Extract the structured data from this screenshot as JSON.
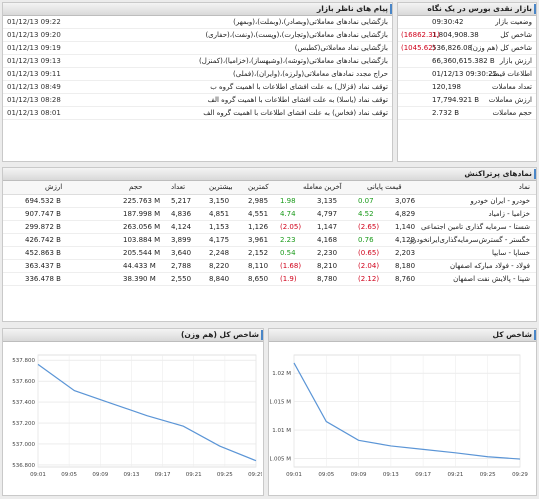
{
  "messages": {
    "title": "پیام های ناظر بازار",
    "items": [
      {
        "time": "01/12/13 09:22",
        "text": "بازگشایی نمادهای معاملاتی(وبصادر)،(وبملت)،(وبمهر)"
      },
      {
        "time": "01/12/13 09:20",
        "text": "بازگشایی نمادهای معاملاتی(وتجارت)،(وپست)،(ونفت)،(حفاری)"
      },
      {
        "time": "01/12/13 09:19",
        "text": "بازگشایی نماد معاملاتی(کطبس)"
      },
      {
        "time": "01/12/13 09:13",
        "text": "بازگشایی نمادهای معاملاتی(وتوشه)،(وشبهساز)،(خزامیا)،(کمنزل)"
      },
      {
        "time": "01/12/13 09:11",
        "text": "حراج مجدد نمادهای معاملاتی(ولرزه)،(وایران)،(فملی)"
      },
      {
        "time": "01/12/13 08:49",
        "text": "توقف نماد (قزلال) به علت افشای اطلاعات با اهمیت گروه ب"
      },
      {
        "time": "01/12/13 08:28",
        "text": "توقف نماد (یاسلا) به علت افشای اطلاعات با اهمیت گروه الف"
      },
      {
        "time": "01/12/13 08:01",
        "text": "توقف نماد (فخاس) به علت افشای اطلاعات با اهمیت گروه الف"
      }
    ]
  },
  "market": {
    "title": "بازار نقدی بورس در یک نگاه",
    "rows": [
      {
        "label": "وضعیت بازار",
        "value": "09:30:42",
        "change": ""
      },
      {
        "label": "شاخص کل",
        "value": "1,804,908.38",
        "change": "(16862.31)"
      },
      {
        "label": "شاخص کل (هم وزن)",
        "value": "536,826.08",
        "change": "(1045.62)"
      },
      {
        "label": "ارزش بازار",
        "value": "66,360,615.382 B",
        "change": ""
      },
      {
        "label": "اطلاعات قیمت",
        "value": "01/12/13 09:30:25",
        "change": ""
      },
      {
        "label": "تعداد معاملات",
        "value": "120,198",
        "change": ""
      },
      {
        "label": "ارزش معاملات",
        "value": "17,794.921 B",
        "change": ""
      },
      {
        "label": "حجم معاملات",
        "value": "2.732 B",
        "change": ""
      }
    ]
  },
  "influential": {
    "title": "نمادهای پرتراکنش",
    "headers": {
      "symbol": "نماد",
      "close": "قیمت پایانی",
      "last": "آخرین معامله",
      "min": "کمترین",
      "max": "بیشترین",
      "count": "تعداد",
      "volume": "حجم",
      "value": "ارزش"
    },
    "rows": [
      {
        "symbol": "خودرو - ایران خودرو",
        "close": "3,076",
        "close_chg": "0.07",
        "last": "3,135",
        "last_chg": "1.98",
        "min": "2,985",
        "max": "3,150",
        "count": "5,217",
        "volume": "225.763 M",
        "value": "694.532 B",
        "close_dir": "pos",
        "last_dir": "pos"
      },
      {
        "symbol": "خزامیا - زامیاد",
        "close": "4,829",
        "close_chg": "4.52",
        "last": "4,797",
        "last_chg": "4.74",
        "min": "4,551",
        "max": "4,851",
        "count": "4,836",
        "volume": "187.998 M",
        "value": "907.747 B",
        "close_dir": "pos",
        "last_dir": "pos"
      },
      {
        "symbol": "شستا - سرمایه گذاری تامین اجتماعی",
        "close": "1,140",
        "close_chg": "(2.65)",
        "last": "1,147",
        "last_chg": "(2.05)",
        "min": "1,126",
        "max": "1,153",
        "count": "4,124",
        "volume": "263.056 M",
        "value": "299.872 B",
        "close_dir": "neg",
        "last_dir": "neg"
      },
      {
        "symbol": "خگستر - گسترش‌سرمایه‌گذاری‌ایرانخودرو",
        "close": "4,129",
        "close_chg": "0.76",
        "last": "4,168",
        "last_chg": "2.23",
        "min": "3,961",
        "max": "4,175",
        "count": "3,899",
        "volume": "103.884 M",
        "value": "426.742 B",
        "close_dir": "pos",
        "last_dir": "pos"
      },
      {
        "symbol": "خساپا - سایپا",
        "close": "2,203",
        "close_chg": "(0.65)",
        "last": "2,230",
        "last_chg": "0.54",
        "min": "2,152",
        "max": "2,248",
        "count": "3,640",
        "volume": "205.544 M",
        "value": "452.863 B",
        "close_dir": "neg",
        "last_dir": "pos"
      },
      {
        "symbol": "فولاد - فولاد مبارکه اصفهان",
        "close": "8,180",
        "close_chg": "(2.04)",
        "last": "8,210",
        "last_chg": "(1.68)",
        "min": "8,110",
        "max": "8,220",
        "count": "2,788",
        "volume": "44.433 M",
        "value": "363.437 B",
        "close_dir": "neg",
        "last_dir": "neg"
      },
      {
        "symbol": "شپنا - پالایش نفت اصفهان",
        "close": "8,760",
        "close_chg": "(2.12)",
        "last": "8,780",
        "last_chg": "(1.9)",
        "min": "8,650",
        "max": "8,840",
        "count": "2,550",
        "volume": "38.390 M",
        "value": "336.478 B",
        "close_dir": "neg",
        "last_dir": "neg"
      }
    ]
  },
  "chart_data": [
    {
      "type": "line",
      "title": "شاخص کل (هم وزن)",
      "x": [
        "09:01",
        "09:05",
        "09:09",
        "09:13",
        "09:17",
        "09:21",
        "09:25",
        "09:29"
      ],
      "y": [
        537.76,
        537.51,
        537.39,
        537.27,
        537.17,
        536.98,
        536.84
      ],
      "x_points": [
        "09:01",
        "09:05",
        "09:09",
        "09:13",
        "09:17",
        "09:21",
        "09:25",
        "09:29"
      ],
      "values": [
        537.76,
        537.51,
        537.39,
        537.27,
        537.17,
        536.98,
        536.84
      ],
      "ytick_values": [
        537.8,
        537.6,
        537.4,
        537.2,
        537.0,
        536.8
      ],
      "ytick_labels": [
        "537.800",
        "537.600",
        "537.400",
        "537.200",
        "537.000",
        "536.800"
      ],
      "ylim": [
        536.78,
        537.85
      ]
    },
    {
      "type": "line",
      "title": "شاخص کل",
      "x_points": [
        "09:01",
        "09:05",
        "09:09",
        "09:13",
        "09:17",
        "09:21",
        "09:25",
        "09:29"
      ],
      "values": [
        1.0218,
        1.0115,
        1.0082,
        1.0072,
        1.0066,
        1.006,
        1.0053,
        1.0049
      ],
      "ytick_values": [
        1.02,
        1.015,
        1.01,
        1.005
      ],
      "ytick_labels": [
        "1.02 M",
        "1.015 M",
        "1.01 M",
        "1.005 M"
      ],
      "ylim": [
        1.0035,
        1.0232
      ]
    }
  ],
  "colors": {
    "accent": "#4a86c7",
    "positive": "#1a9a1a",
    "negative": "#d0021b",
    "line": "#5b95d6"
  }
}
